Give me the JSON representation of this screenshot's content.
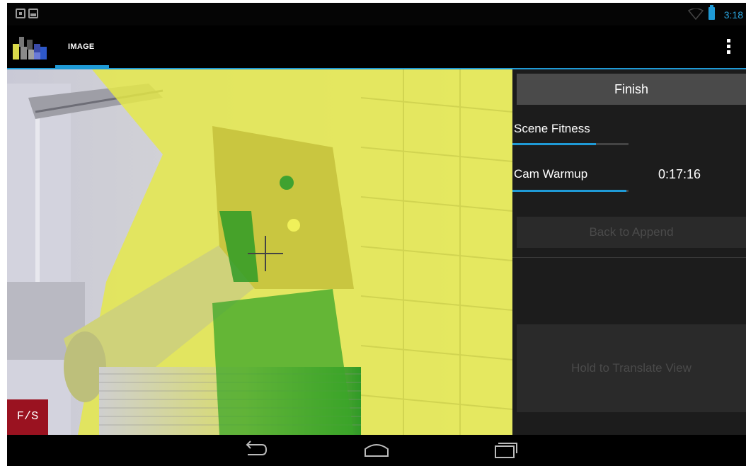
{
  "status_bar": {
    "time": "3:18",
    "icons": [
      "notification-icon",
      "image-notification-icon",
      "wifi-icon",
      "battery-icon"
    ]
  },
  "action_bar": {
    "tab_label": "IMAGE",
    "icons": [
      "app-logo-icon",
      "overflow-menu-icon"
    ]
  },
  "camera_view": {
    "fs_button": "F/S"
  },
  "panel": {
    "finish_button": "Finish",
    "scene_fitness": {
      "label": "Scene Fitness",
      "progress": 0.72
    },
    "cam_warmup": {
      "label": "Cam Warmup",
      "progress": 0.98,
      "timer": "0:17:16"
    },
    "back_to_append": "Back to Append",
    "hold_to_translate": "Hold to Translate View"
  },
  "nav_bar": {
    "icons": [
      "back-icon",
      "home-icon",
      "recent-apps-icon"
    ]
  },
  "colors": {
    "accent": "#1f9ad6",
    "fs_button": "#9a1220",
    "overlay_yellow": "#e6ea3a",
    "overlay_green": "#3aa628"
  }
}
